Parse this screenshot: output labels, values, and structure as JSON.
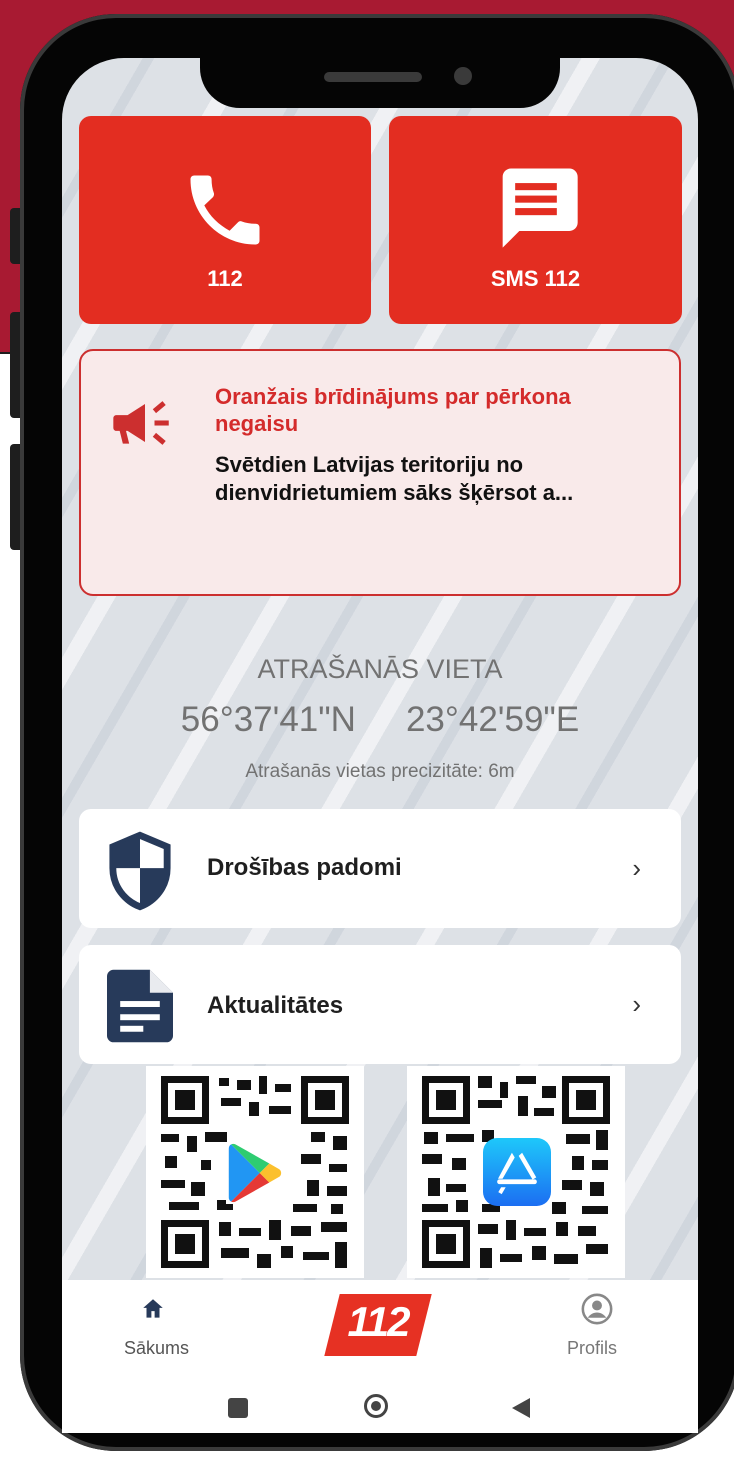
{
  "tiles": {
    "call": {
      "label": "112"
    },
    "sms": {
      "label": "SMS 112"
    }
  },
  "alert": {
    "title": "Oranžais brīdinājums par pērkona negaisu",
    "body": "Svētdien Latvijas teritoriju no dienvidrietumiem sāks šķērsot a..."
  },
  "location": {
    "heading": "ATRAŠANĀS VIETA",
    "lat": "56°37'41\"N",
    "lon": "23°42'59\"E",
    "accuracy": "Atrašanās vietas precizitāte: 6m"
  },
  "menu": {
    "safety": {
      "label": "Drošības padomi"
    },
    "news": {
      "label": "Aktualitātes"
    }
  },
  "bottom_nav": {
    "home": "Sākums",
    "logo": "112",
    "profile": "Profils"
  },
  "icons": [
    "phone-icon",
    "message-icon",
    "megaphone-icon",
    "shield-icon",
    "document-icon",
    "chevron-right-icon",
    "home-icon",
    "profile-icon",
    "google-play-icon",
    "app-store-icon"
  ],
  "colors": {
    "brand_red": "#e32d21",
    "alert_red": "#d42b2b",
    "alert_bg": "#f9eaea",
    "icon_navy": "#273a5a",
    "background_red": "#a81a32"
  }
}
